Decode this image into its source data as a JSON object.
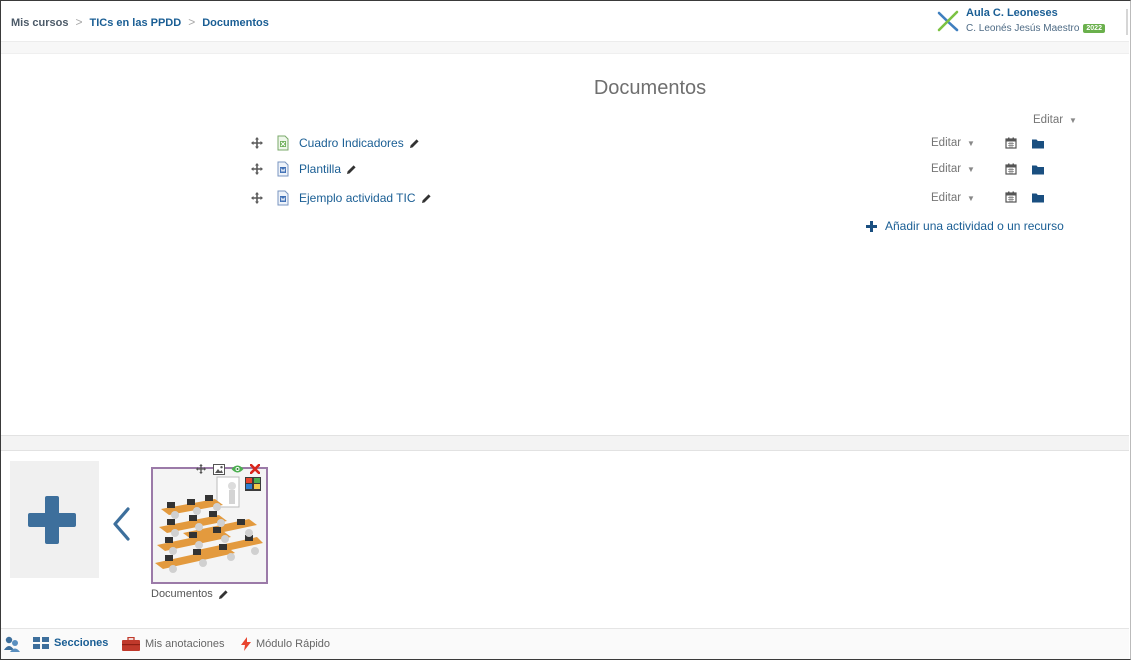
{
  "breadcrumb": {
    "items": [
      "Mis cursos",
      "TICs en las PPDD",
      "Documentos"
    ],
    "separator": ">"
  },
  "brand": {
    "title": "Aula C. Leoneses",
    "user": "C. Leonés Jesús Maestro",
    "year_badge": "2022"
  },
  "section": {
    "title": "Documentos",
    "edit_label": "Editar",
    "activities": [
      {
        "name": "Cuadro Indicadores",
        "icon": "spreadsheet-icon",
        "edit_label": "Editar"
      },
      {
        "name": "Plantilla",
        "icon": "document-icon",
        "edit_label": "Editar"
      },
      {
        "name": "Ejemplo actividad TIC",
        "icon": "document-icon",
        "edit_label": "Editar"
      }
    ],
    "add_activity_label": "Añadir una actividad o un recurso"
  },
  "carousel": {
    "thumbnail_caption": "Documentos"
  },
  "footer": {
    "items": [
      "Secciones",
      "Mis anotaciones",
      "Módulo Rápido"
    ]
  },
  "colors": {
    "link": "#1a5e94",
    "accent_blue": "#3d6f9c",
    "thumbnail_border": "#9b7aa8",
    "delete_red": "#d9261c",
    "eye_green": "#4caf50"
  }
}
